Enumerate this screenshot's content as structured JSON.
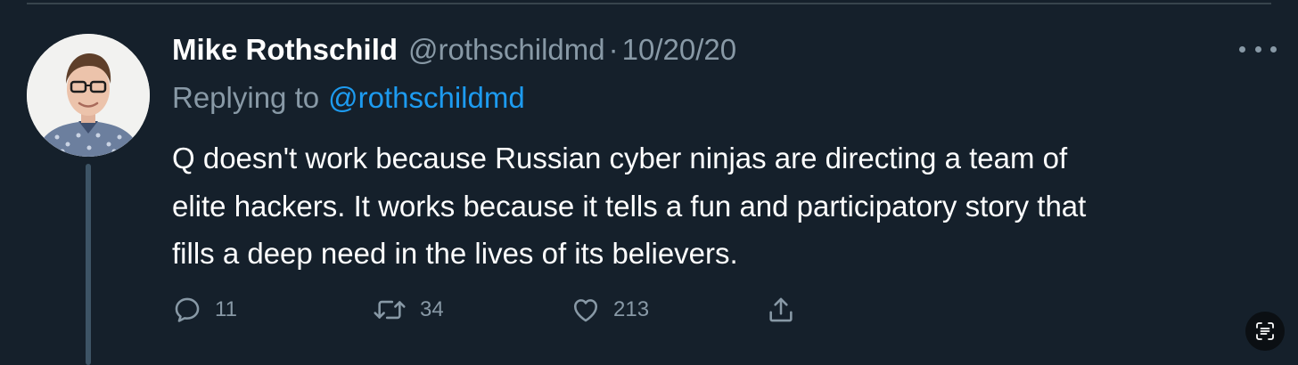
{
  "tweet": {
    "author_name": "Mike Rothschild",
    "author_handle": "@rothschildmd",
    "separator": "·",
    "date": "10/20/20",
    "replying_prefix": "Replying to",
    "replying_to_handle": "@rothschildmd",
    "text_lines": [
      "Q doesn't work because Russian cyber ninjas are directing a team of",
      "elite hackers. It works because it tells a fun and participatory story that",
      "fills a deep need in the lives of its believers."
    ],
    "stats": {
      "replies": "11",
      "retweets": "34",
      "likes": "213"
    }
  },
  "icons": {
    "more": "more-horizontal-icon",
    "reply": "comment-bubble-icon",
    "retweet": "retweet-arrows-icon",
    "like": "heart-outline-icon",
    "share": "share-upload-icon",
    "scan": "scan-text-icon"
  },
  "colors": {
    "background": "#15202b",
    "text_primary": "#ffffff",
    "text_secondary": "#8899a6",
    "link": "#1d9bf0",
    "thread_line": "#3d5466"
  }
}
